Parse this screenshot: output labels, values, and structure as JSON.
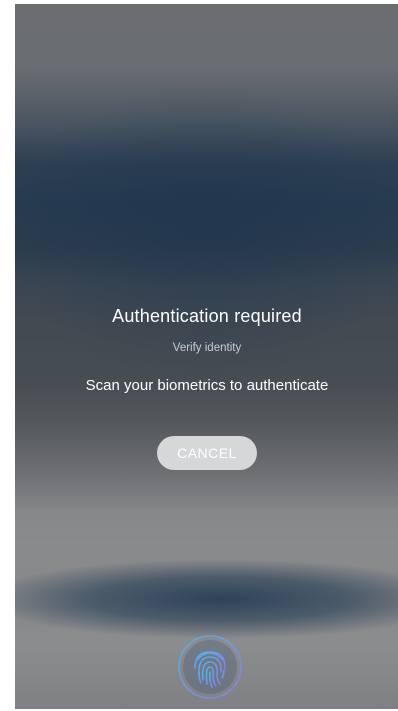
{
  "dialog": {
    "title": "Authentication required",
    "subtitle": "Verify identity",
    "message": "Scan your biometrics to authenticate",
    "cancel_label": "CANCEL"
  },
  "icons": {
    "fingerprint": "fingerprint-icon"
  },
  "colors": {
    "fingerprint_accent": "#4db6f2",
    "fingerprint_ring": "#7f8be8"
  }
}
